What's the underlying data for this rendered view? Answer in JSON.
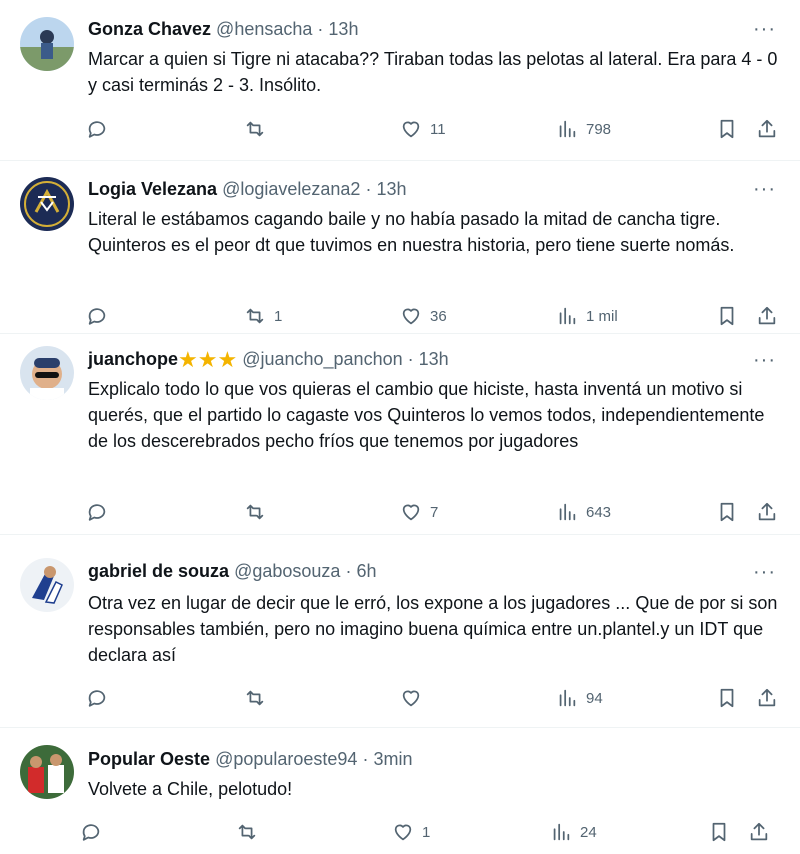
{
  "tweets": [
    {
      "name": "Gonza Chavez",
      "handle": "@hensacha",
      "time": "13h",
      "text": "Marcar a quien si Tigre ni atacaba?? Tiraban todas las pelotas al lateral. Era para 4 - 0 y casi terminás 2 - 3. Insólito.",
      "replies": "",
      "retweets": "",
      "likes": "11",
      "views": "798"
    },
    {
      "name": "Logia Velezana",
      "handle": "@logiavelezana2",
      "time": "13h",
      "text": "Literal le estábamos cagando baile y no había pasado la mitad de cancha tigre. Quinteros es el peor dt que tuvimos en nuestra historia, pero tiene suerte nomás.",
      "replies": "",
      "retweets": "1",
      "likes": "36",
      "views": "1 mil"
    },
    {
      "name": "juanchope",
      "name_emoji": "★★★",
      "handle": "@juancho_panchon",
      "time": "13h",
      "text": "Explicalo todo lo que vos quieras el cambio que hiciste, hasta inventá un motivo si querés, que el partido lo cagaste vos Quinteros lo vemos todos, independientemente de los descerebrados pecho fríos que tenemos por jugadores",
      "replies": "",
      "retweets": "",
      "likes": "7",
      "views": "643"
    },
    {
      "name": "gabriel de souza",
      "handle": "@gabosouza",
      "time": "6h",
      "text": "Otra vez en lugar de decir que le erró, los expone a los jugadores ... Que de por si son responsables también, pero no imagino buena química entre un.plantel.y un IDT que declara así",
      "replies": "",
      "retweets": "",
      "likes": "",
      "views": "94"
    },
    {
      "name": "Popular Oeste",
      "handle": "@popularoeste94",
      "time": "3min",
      "text": "Volvete a Chile, pelotudo!",
      "replies": "",
      "retweets": "",
      "likes": "1",
      "views": "24"
    }
  ],
  "separator": "·",
  "more_label": "···",
  "icons": [
    "reply-icon",
    "retweet-icon",
    "like-icon",
    "views-icon",
    "bookmark-icon",
    "share-icon"
  ],
  "colors": {
    "text": "#0f1419",
    "secondary": "#536471",
    "divider": "#eff3f4",
    "star": "#f4b400"
  }
}
